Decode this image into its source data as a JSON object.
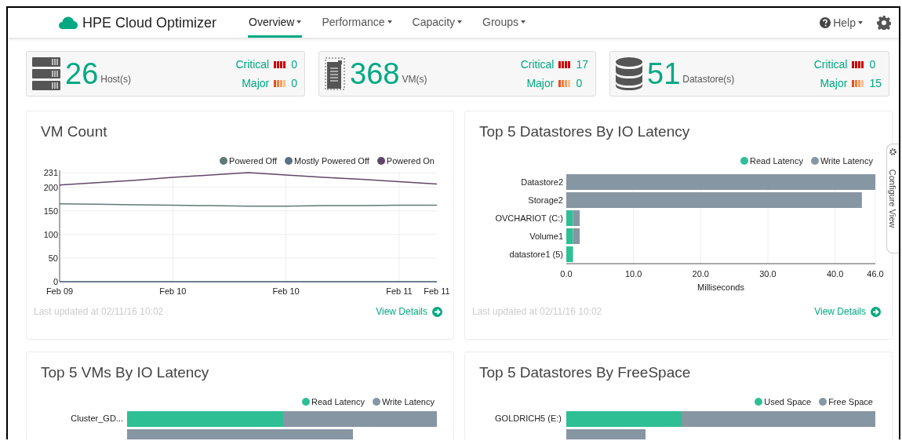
{
  "header": {
    "logo": "HPE Cloud Optimizer",
    "nav": [
      {
        "label": "Overview",
        "selected": true
      },
      {
        "label": "Performance",
        "selected": false
      },
      {
        "label": "Capacity",
        "selected": false
      },
      {
        "label": "Groups",
        "selected": false
      }
    ],
    "help": "Help"
  },
  "summary": [
    {
      "kind": "host",
      "count": "26",
      "unit": "Host(s)",
      "critical_label": "Critical",
      "critical": "0",
      "major_label": "Major",
      "major": "0"
    },
    {
      "kind": "vm",
      "count": "368",
      "unit": "VM(s)",
      "critical_label": "Critical",
      "critical": "17",
      "major_label": "Major",
      "major": "0"
    },
    {
      "kind": "datastore",
      "count": "51",
      "unit": "Datastore(s)",
      "critical_label": "Critical",
      "critical": "0",
      "major_label": "Major",
      "major": "15"
    }
  ],
  "panels": [
    {
      "kind": "line",
      "title": "VM Count",
      "chart_data": {
        "type": "line",
        "grid": true,
        "ylim": [
          0,
          231
        ],
        "categories": [
          "Feb 09",
          null,
          null,
          "Feb 10",
          null,
          null,
          "Feb 10",
          null,
          null,
          "Feb 11",
          "Feb 11"
        ],
        "yticks": [
          0,
          50,
          100,
          150,
          200,
          231
        ],
        "series": [
          {
            "name": "Powered Off",
            "color": "#5f7a76",
            "values": [
              165,
              164,
              163,
              162,
              161,
              160,
              160,
              161,
              161,
              162,
              162
            ]
          },
          {
            "name": "Mostly Powered Off",
            "color": "#5d7184",
            "values": [
              0,
              0,
              0,
              0,
              0,
              0,
              0,
              0,
              0,
              0,
              0
            ]
          },
          {
            "name": "Powered On",
            "color": "#614767",
            "values": [
              205,
              210,
              215,
              221,
              226,
              231,
              226,
              221,
              217,
              212,
              207
            ]
          }
        ]
      },
      "updated": "Last updated at 02/11/16 10:02",
      "link": "View Details"
    },
    {
      "kind": "hbar",
      "title": "Top 5 Datastores By IO Latency",
      "chart_data": {
        "type": "bar",
        "orientation": "horizontal",
        "stacked": true,
        "grid": true,
        "xlabel": "Milliseconds",
        "categories": [
          "Datastore2",
          "Storage2",
          "OVCHARIOT (C:)",
          "Volume1",
          "datastore1 (5)"
        ],
        "xlim": [
          0,
          46
        ],
        "xticks": [
          {
            "value": 0,
            "label": "0.0"
          },
          {
            "value": 10,
            "label": "10.0"
          },
          {
            "value": 20,
            "label": "20.0"
          },
          {
            "value": 30,
            "label": "30.0"
          },
          {
            "value": 40,
            "label": "40.0"
          },
          {
            "value": 46,
            "label": "46.0"
          }
        ],
        "series": [
          {
            "name": "Read Latency",
            "color": "#2ebf95",
            "values": [
              0,
              0,
              1,
              1,
              1
            ]
          },
          {
            "name": "Write Latency",
            "color": "#8796a3",
            "values": [
              46,
              44,
              1,
              1,
              0
            ]
          }
        ]
      },
      "updated": "Last updated at 02/11/16 10:02",
      "link": "View Details"
    },
    {
      "kind": "preview",
      "title": "Top 5 VMs By IO Latency",
      "legend": [
        {
          "name": "Read Latency",
          "color": "#2ebf95"
        },
        {
          "name": "Write Latency",
          "color": "#8796a3"
        }
      ],
      "rows": [
        "Cluster_GD..."
      ]
    },
    {
      "kind": "preview",
      "title": "Top 5 Datastores By FreeSpace",
      "legend": [
        {
          "name": "Used Space",
          "color": "#2ebf95"
        },
        {
          "name": "Free Space",
          "color": "#8796a3"
        }
      ],
      "rows": [
        "GOLDRICH5 (E:)"
      ]
    }
  ],
  "side_tab": {
    "label": "Configure View"
  }
}
